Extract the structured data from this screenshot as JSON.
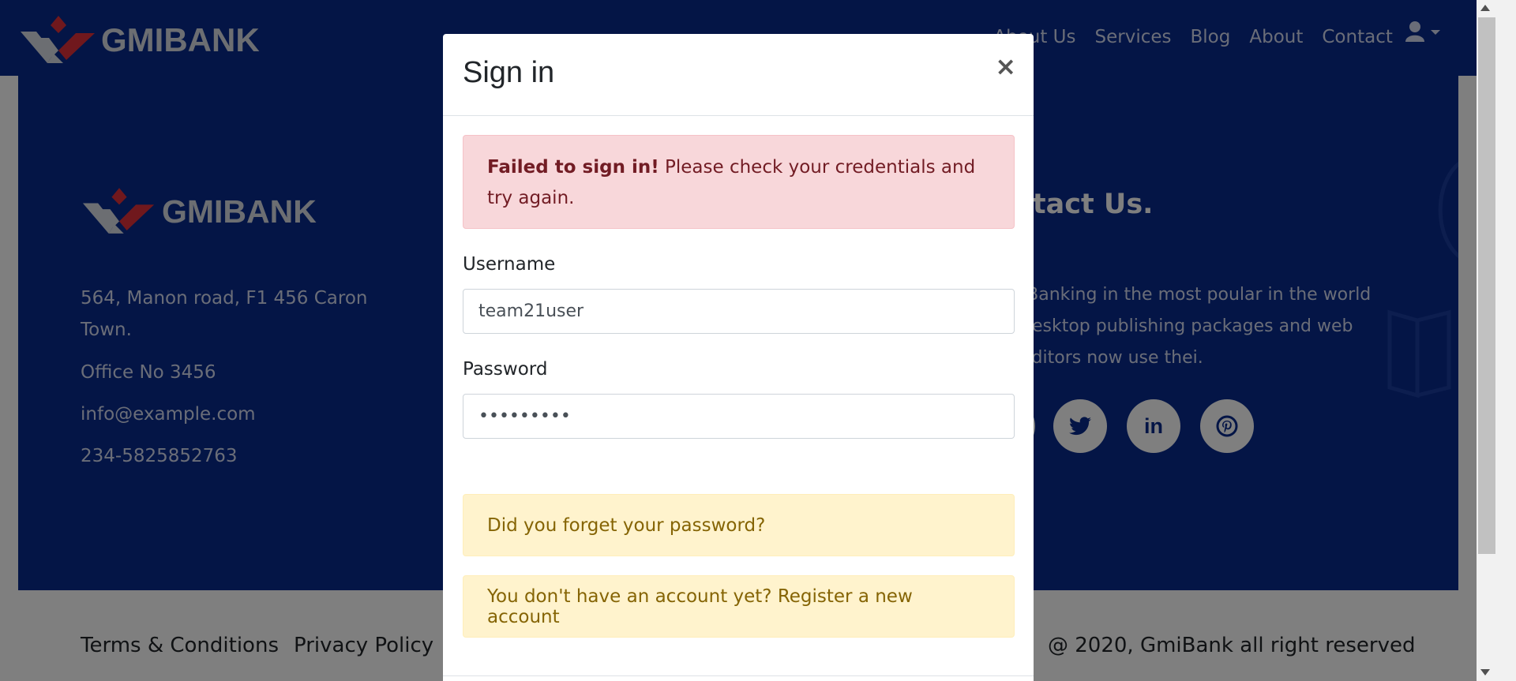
{
  "navbar": {
    "brand": "GMIBANK",
    "links": [
      "About Us",
      "Services",
      "Blog",
      "About",
      "Contact"
    ]
  },
  "footer": {
    "brand": "GMIBANK",
    "address_line1": "564, Manon road, F1 456 Caron",
    "address_line2": "Town.",
    "office": "Office No 3456",
    "email": "info@example.com",
    "phone": "234-5825852763",
    "contact_title": "ntact Us.",
    "contact_text_1": "-Banking in the most poular in the world",
    "contact_text_2": "desktop publishing packages and web",
    "contact_text_3": "editors now use thei.",
    "terms": "Terms & Conditions",
    "privacy": "Privacy Policy",
    "copyright": "@ 2020, GmiBank all right reserved"
  },
  "modal": {
    "title": "Sign in",
    "close": "×",
    "error_strong": "Failed to sign in!",
    "error_text": " Please check your credentials and try again.",
    "username_label": "Username",
    "username_value": "team21user",
    "password_label": "Password",
    "password_value": "•••••••••",
    "forgot_password": "Did you forget your password?",
    "register_text": "You don't have an account yet? Register a new account"
  },
  "colors": {
    "brand_blue": "#082a8c",
    "brand_red": "#e0303a",
    "danger_bg": "#f8d7da",
    "warning_bg": "#fff3cd"
  }
}
